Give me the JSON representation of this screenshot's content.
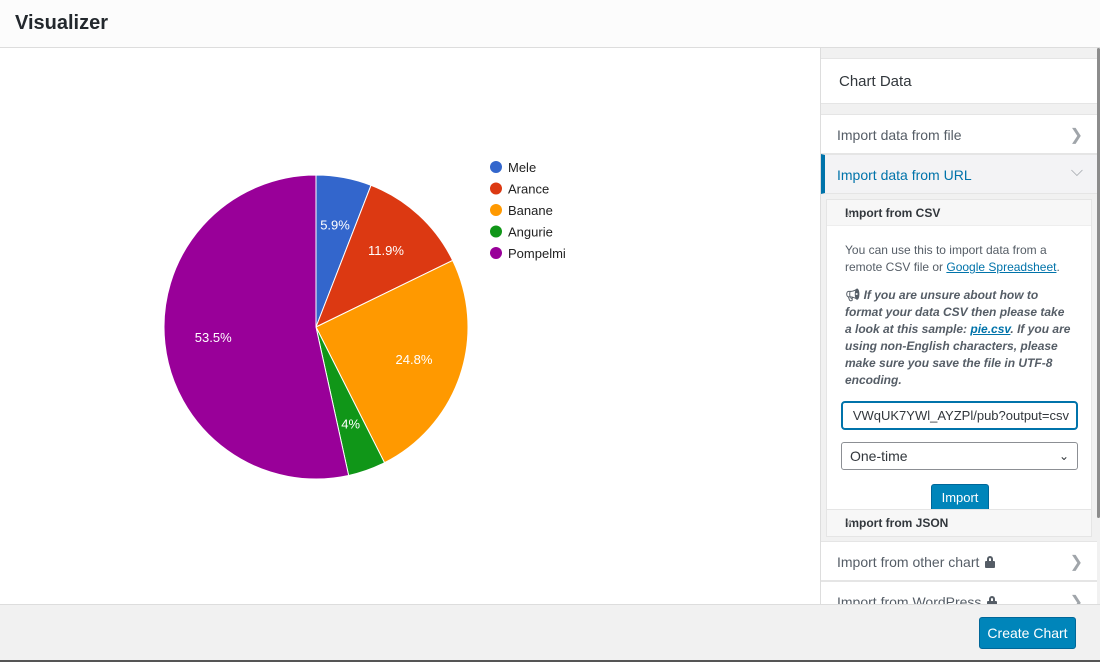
{
  "header": {
    "title": "Visualizer"
  },
  "chart_data": {
    "type": "pie",
    "title": "",
    "categories": [
      "Mele",
      "Arance",
      "Banane",
      "Angurie",
      "Pompelmi"
    ],
    "values": [
      5.9,
      11.9,
      24.8,
      4.0,
      53.5
    ],
    "labels": [
      "5.9%",
      "11.9%",
      "24.8%",
      "4%",
      "53.5%"
    ],
    "colors": [
      "#3366cc",
      "#dc3912",
      "#ff9900",
      "#109618",
      "#990099"
    ],
    "legend": "right"
  },
  "sidebar": {
    "title": "Chart Data",
    "sections": [
      {
        "label": "Import data from file",
        "state": "collapsed"
      },
      {
        "label": "Import data from URL",
        "state": "expanded"
      }
    ],
    "csv_panel": {
      "title": "Import from CSV",
      "intro_prefix": "You can use this to import data from a remote CSV file or ",
      "intro_link": "Google Spreadsheet",
      "intro_suffix": ".",
      "note_icon": "megaphone-icon",
      "note_prefix": " If you are unsure about how to format your data CSV then please take a look at this sample: ",
      "note_link": "pie.csv",
      "note_suffix": ". If you are using non-English characters, please make sure you save the file in UTF-8 encoding.",
      "url_value": "VWqUK7YWl_AYZPl/pub?output=csv",
      "schedule_value": "One-time",
      "import_label": "Import"
    },
    "json_panel": {
      "title": "Import from JSON"
    },
    "more_sections": [
      {
        "label": "Import from other chart",
        "locked": true
      },
      {
        "label": "Import from WordPress",
        "locked": true
      }
    ]
  },
  "footer": {
    "create_label": "Create Chart"
  }
}
